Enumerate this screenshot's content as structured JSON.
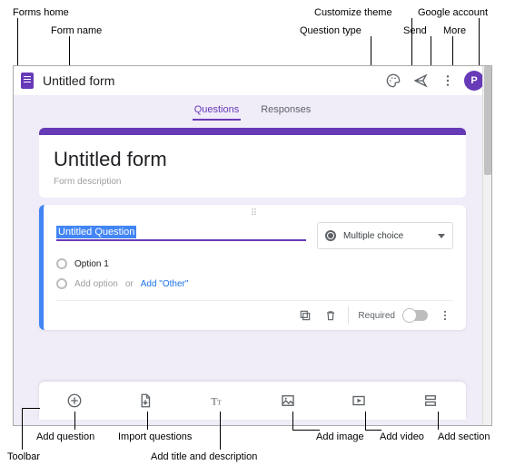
{
  "callouts": {
    "forms_home": "Forms home",
    "form_name": "Form name",
    "customize_theme": "Customize theme",
    "question_type": "Question type",
    "send": "Send",
    "google_account": "Google account",
    "more": "More",
    "add_question": "Add question",
    "import_questions": "Import questions",
    "add_title_desc": "Add title and description",
    "add_image": "Add image",
    "add_video": "Add video",
    "add_section": "Add section",
    "toolbar": "Toolbar"
  },
  "topbar": {
    "title": "Untitled form",
    "avatar_initial": "P"
  },
  "tabs": {
    "questions": "Questions",
    "responses": "Responses"
  },
  "form_header": {
    "title": "Untitled form",
    "description": "Form description"
  },
  "question": {
    "title": "Untitled Question",
    "type_label": "Multiple choice",
    "option1": "Option 1",
    "add_option_text": "Add option",
    "or_text": "or",
    "add_other_text": "Add \"Other\"",
    "required_label": "Required"
  }
}
